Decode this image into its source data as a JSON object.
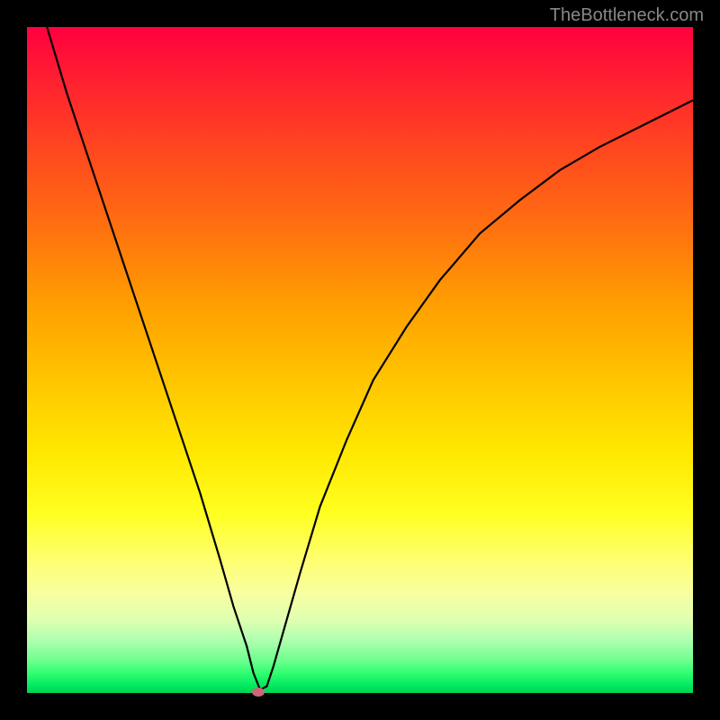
{
  "watermark": "TheBottleneck.com",
  "chart_data": {
    "type": "line",
    "title": "",
    "xlabel": "",
    "ylabel": "",
    "xlim": [
      0,
      100
    ],
    "ylim": [
      0,
      100
    ],
    "series": [
      {
        "name": "curve",
        "x": [
          3,
          6,
          10,
          14,
          18,
          22,
          26,
          29,
          31,
          33,
          34,
          35,
          36,
          37,
          39,
          41,
          44,
          48,
          52,
          57,
          62,
          68,
          74,
          80,
          86,
          92,
          100
        ],
        "y": [
          100,
          90,
          78,
          66,
          54,
          42,
          30,
          20,
          13,
          7,
          3,
          0.5,
          1,
          4,
          11,
          18,
          28,
          38,
          47,
          55,
          62,
          69,
          74,
          78.5,
          82,
          85,
          89
        ]
      }
    ],
    "marker": {
      "x": 34.7,
      "y": 0.2
    },
    "gradient_stops": [
      {
        "pct": 0,
        "color": "#ff0040"
      },
      {
        "pct": 50,
        "color": "#ffc800"
      },
      {
        "pct": 80,
        "color": "#ffff70"
      },
      {
        "pct": 100,
        "color": "#00d050"
      }
    ]
  }
}
